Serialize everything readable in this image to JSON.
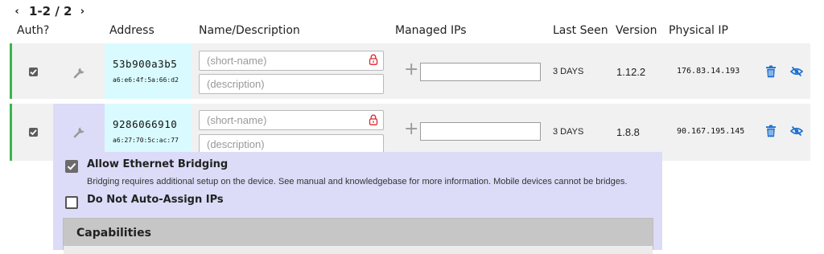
{
  "pagination": {
    "range": "1-2 / 2",
    "prev_icon": "chevron-left-icon",
    "next_icon": "chevron-right-icon"
  },
  "columns": {
    "auth": "Auth?",
    "address": "Address",
    "name": "Name/Description",
    "managed_ips": "Managed IPs",
    "last_seen": "Last Seen",
    "version": "Version",
    "physical_ip": "Physical IP"
  },
  "members": [
    {
      "authorized": true,
      "node_id": "53b900a3b5",
      "mac": "a6:e6:4f:5a:66:d2",
      "short_name_placeholder": "(short-name)",
      "description_placeholder": "(description)",
      "managed_ip_value": "",
      "last_seen": "3 DAYS",
      "version": "1.12.2",
      "physical_ip": "176.83.14.193"
    },
    {
      "authorized": true,
      "node_id": "9286066910",
      "mac": "a6:27:70:5c:ac:77",
      "short_name_placeholder": "(short-name)",
      "description_placeholder": "(description)",
      "managed_ip_value": "",
      "last_seen": "3 DAYS",
      "version": "1.8.8",
      "physical_ip": "90.167.195.145"
    }
  ],
  "member_settings": {
    "bridging": {
      "checked": true,
      "label": "Allow Ethernet Bridging",
      "description": "Bridging requires additional setup on the device. See manual and knowledgebase for more information. Mobile devices cannot be bridges."
    },
    "no_auto_assign": {
      "checked": false,
      "label": "Do Not Auto-Assign IPs"
    },
    "capabilities_title": "Capabilities"
  },
  "colors": {
    "accent_blue": "#1a6fd1",
    "lock_red": "#d9272e",
    "authorized_green": "#3bb54a",
    "address_bg": "#d9fbff",
    "settings_bg": "#dcdcf8"
  }
}
